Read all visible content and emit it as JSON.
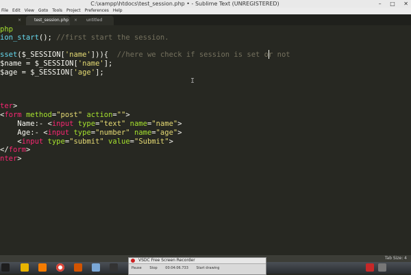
{
  "window": {
    "title": "C:\\xampp\\htdocs\\test_session.php • - Sublime Text (UNREGISTERED)",
    "min": "–",
    "max": "□",
    "close": "✕"
  },
  "menu": [
    "File",
    "Edit",
    "View",
    "Goto",
    "Tools",
    "Project",
    "Preferences",
    "Help"
  ],
  "tabs": [
    {
      "label": "",
      "close": "×"
    },
    {
      "label": "test_session.php",
      "close": "×"
    },
    {
      "label": "untitled",
      "close": "×"
    }
  ],
  "code": {
    "l1": "php",
    "l2a": "ion_start",
    "l2b": "();",
    "l2c": " //first start the session.",
    "l3a": "sset",
    "l3b": "(",
    "l3c": "$_SESSION",
    "l3d": "[",
    "l3e": "'name'",
    "l3f": "])){",
    "l3g": "  //here we check if session is set or not",
    "l4a": "$name = $_SESSION[",
    "l4b": "'name'",
    "l4c": "];",
    "l5a": "$age = $_SESSION[",
    "l5b": "'age'",
    "l5c": "];",
    "l6a": "ter",
    "l6b": ">",
    "l7a": "<",
    "l7b": "form",
    "l7c": " method",
    "l7d": "=",
    "l7e": "\"post\"",
    "l7f": " action",
    "l7g": "=",
    "l7h": "\"\"",
    "l7i": ">",
    "l8a": "    Name:- <",
    "l8b": "input",
    "l8c": " type",
    "l8d": "=",
    "l8e": "\"text\"",
    "l8f": " name",
    "l8g": "=",
    "l8h": "\"name\"",
    "l8i": ">",
    "l9a": "    Age:- <",
    "l9b": "input",
    "l9c": " type",
    "l9d": "=",
    "l9e": "\"number\"",
    "l9f": " name",
    "l9g": "=",
    "l9h": "\"age\"",
    "l9i": ">",
    "l10a": "    <",
    "l10b": "input",
    "l10c": " type",
    "l10d": "=",
    "l10e": "\"submit\"",
    "l10f": " value",
    "l10g": "=",
    "l10h": "\"Submit\"",
    "l10i": ">",
    "l11a": "</",
    "l11b": "form",
    "l11c": ">",
    "l12a": "nter",
    "l12b": ">"
  },
  "status": {
    "right": "Tab Size: 4"
  },
  "recorder": {
    "title": "VSDC Free Screen Recorder",
    "pause": "Pause",
    "stop": "Stop",
    "time": "00:04:06.733",
    "start": "Start drawing"
  },
  "colors": {
    "bg": "#272822",
    "keyword": "#f92672",
    "string": "#e6db74",
    "function": "#66d9ef",
    "attr": "#a6e22e",
    "comment": "#75715e"
  }
}
